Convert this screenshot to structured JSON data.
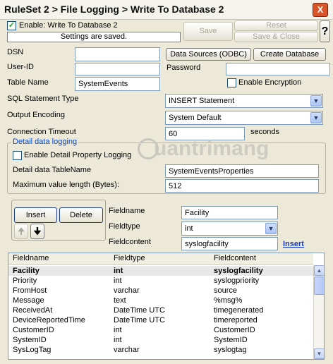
{
  "window": {
    "title": "RuleSet 2 > File Logging > Write To Database 2",
    "close_label": "X"
  },
  "top": {
    "enable_label": "Enable: Write To Database 2",
    "enable_checked": true,
    "status": "Settings are saved.",
    "save_label": "Save",
    "reset_label": "Reset",
    "save_close_label": "Save & Close",
    "help_label": "?"
  },
  "form": {
    "dsn_label": "DSN",
    "dsn_value": "",
    "data_sources_label": "Data Sources (ODBC)",
    "create_db_label": "Create Database",
    "userid_label": "User-ID",
    "userid_value": "",
    "password_label": "Password",
    "password_value": "",
    "table_label": "Table Name",
    "table_value": "SystemEvents",
    "encryption_label": "Enable Encryption",
    "sql_label": "SQL Statement Type",
    "sql_value": "INSERT Statement",
    "encoding_label": "Output Encoding",
    "encoding_value": "System Default",
    "timeout_label": "Connection Timeout",
    "timeout_value": "60",
    "timeout_unit": "seconds"
  },
  "detail": {
    "legend": "Detail data logging",
    "enable_label": "Enable Detail Property Logging",
    "tablename_label": "Detail data TableName",
    "tablename_value": "SystemEventsProperties",
    "maxlen_label": "Maximum value length (Bytes):",
    "maxlen_value": "512"
  },
  "fields": {
    "insert_label": "Insert",
    "delete_label": "Delete",
    "fieldname_label": "Fieldname",
    "fieldname_value": "Facility",
    "fieldtype_label": "Fieldtype",
    "fieldtype_value": "int",
    "fieldcontent_label": "Fieldcontent",
    "fieldcontent_value": "syslogfacility",
    "insert_link": "Insert"
  },
  "table": {
    "columns": [
      "Fieldname",
      "Fieldtype",
      "Fieldcontent"
    ],
    "rows": [
      [
        "Facility",
        "int",
        "syslogfacility"
      ],
      [
        "Priority",
        "int",
        "syslogpriority"
      ],
      [
        "FromHost",
        "varchar",
        "source"
      ],
      [
        "Message",
        "text",
        "%msg%"
      ],
      [
        "ReceivedAt",
        "DateTime UTC",
        "timegenerated"
      ],
      [
        "DeviceReportedTime",
        "DateTime UTC",
        "timereported"
      ],
      [
        "CustomerID",
        "int",
        "CustomerID"
      ],
      [
        "SystemID",
        "int",
        "SystemID"
      ],
      [
        "SysLogTag",
        "varchar",
        "syslogtag"
      ]
    ]
  },
  "watermark": "uantrimang",
  "colors": {
    "accent": "#0046d5",
    "link": "#1a3cbf",
    "checkmark": "#21a121",
    "window_bg": "#ece9d8"
  }
}
